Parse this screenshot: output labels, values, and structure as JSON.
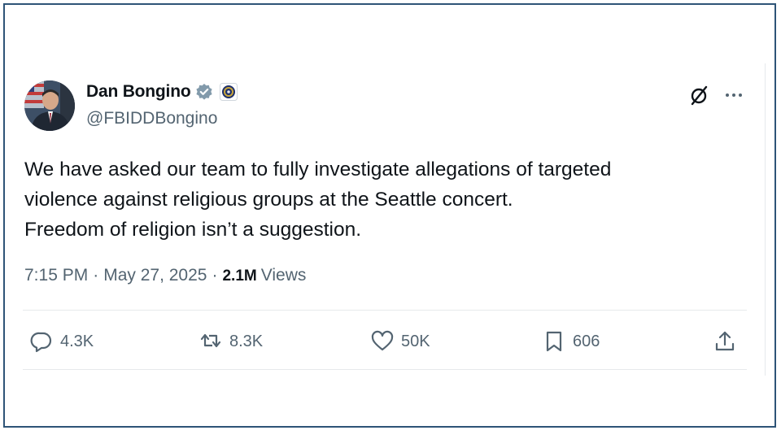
{
  "author": {
    "name": "Dan Bongino",
    "handle": "@FBIDDBongino",
    "verified_color": "#829aab",
    "avatar": "avatar-photo"
  },
  "tweet": {
    "lines": [
      "We have asked our team to fully investigate allegations of targeted",
      "violence against religious groups at the Seattle concert.",
      "Freedom of religion isn’t a suggestion."
    ]
  },
  "meta": {
    "time": "7:15 PM",
    "separator": "·",
    "date": "May 27, 2025",
    "views_count": "2.1M",
    "views_label": "Views"
  },
  "actions": {
    "replies": "4.3K",
    "reposts": "8.3K",
    "likes": "50K",
    "bookmarks": "606"
  },
  "icons": [
    "grok-icon",
    "more-icon",
    "reply-icon",
    "repost-icon",
    "like-icon",
    "bookmark-icon",
    "share-icon",
    "verified-badge-icon",
    "fbi-seal-icon"
  ],
  "colors": {
    "text": "#0f1419",
    "secondary": "#536471",
    "border": "#2e5477"
  }
}
